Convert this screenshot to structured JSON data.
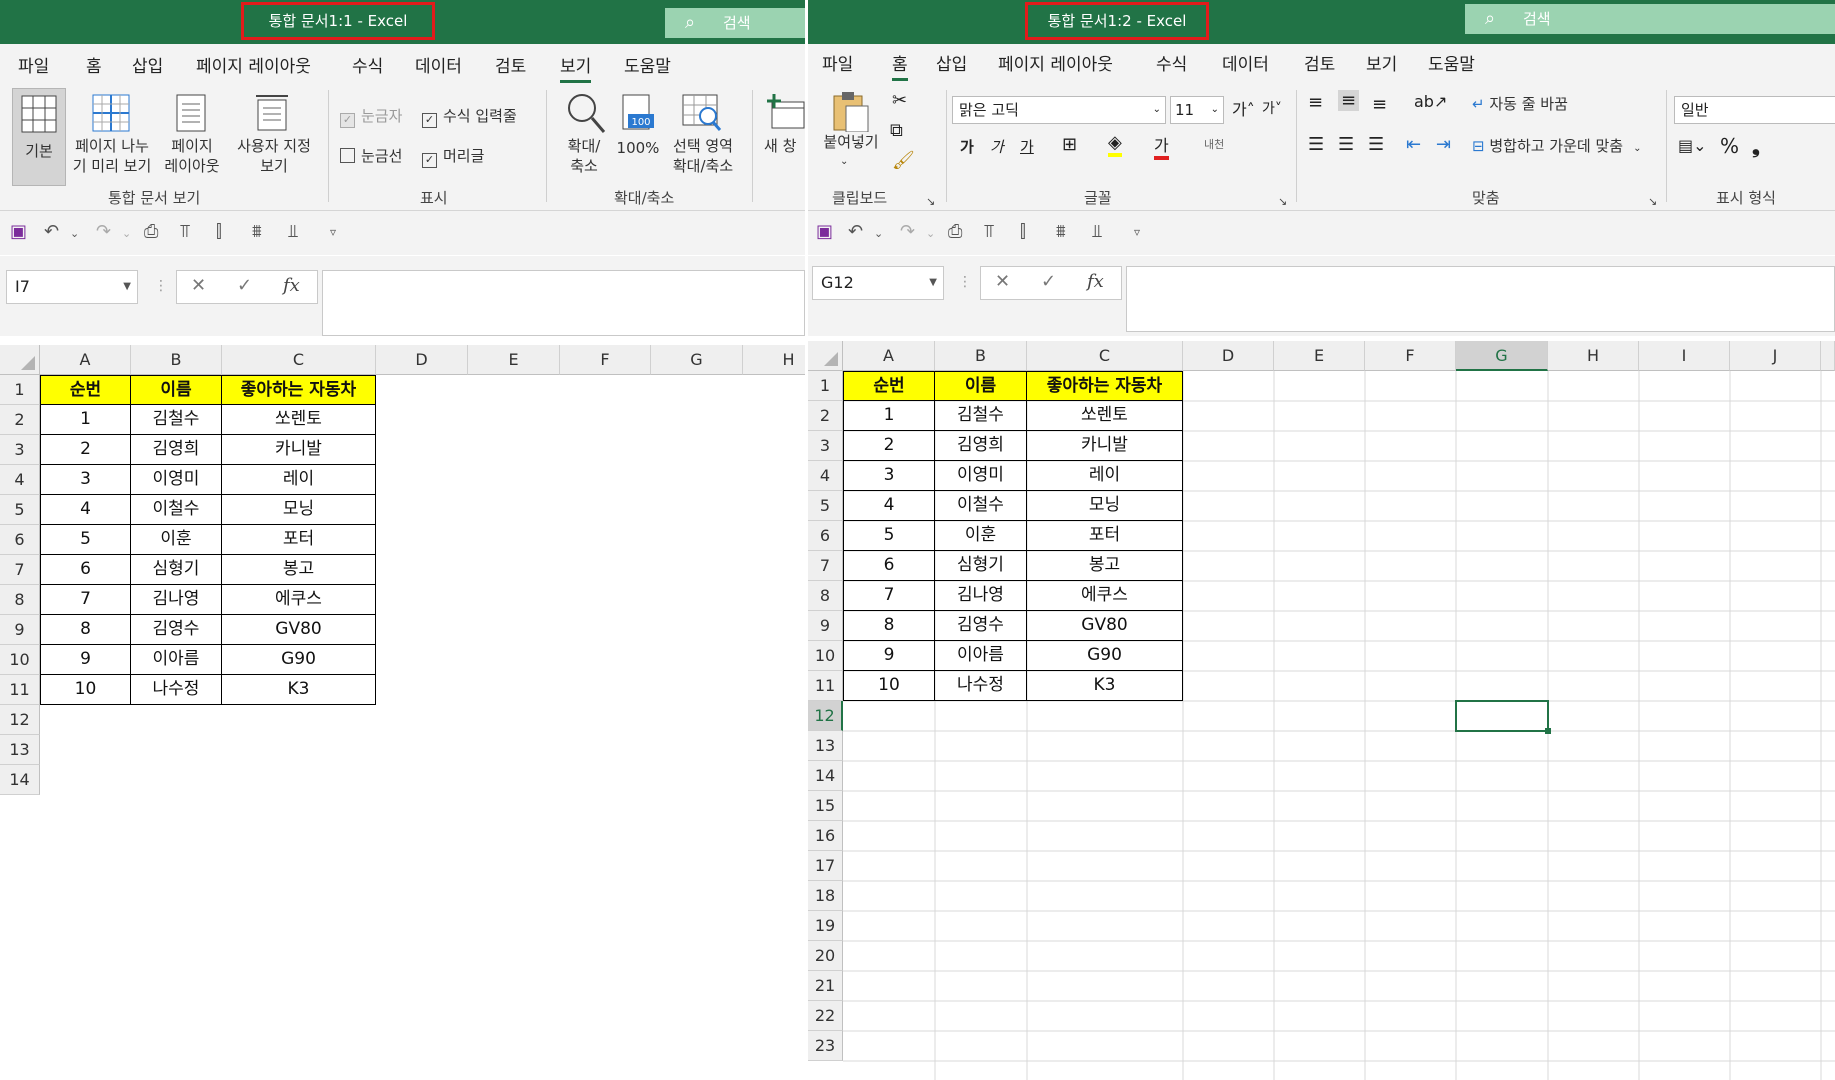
{
  "left": {
    "title": "통합 문서1:1  -  Excel",
    "search": "검색",
    "menus": [
      "파일",
      "홈",
      "삽입",
      "페이지 레이아웃",
      "수식",
      "데이터",
      "검토",
      "보기",
      "도움말"
    ],
    "active_menu_index": 7,
    "ribbon": {
      "normal": "기본",
      "pagebreak": "페이지 나누\n기 미리 보기",
      "pagelayout": "페이지\n레이아웃",
      "custom": "사용자 지정\n보기",
      "group_views": "통합 문서 보기",
      "ruler": "눈금자",
      "formula_bar": "수식 입력줄",
      "gridlines": "눈금선",
      "headings": "머리글",
      "group_show": "표시",
      "zoom": "확대/\n축소",
      "zoom100": "100%",
      "zoom_sel": "선택 영역\n확대/축소",
      "group_zoom": "확대/축소",
      "new_window": "새 창"
    },
    "namebox": "I7",
    "columns": [
      "A",
      "B",
      "C",
      "D",
      "E",
      "F",
      "G",
      "H"
    ],
    "rows": [
      "1",
      "2",
      "3",
      "4",
      "5",
      "6",
      "7",
      "8",
      "9",
      "10",
      "11",
      "12",
      "13",
      "14"
    ]
  },
  "right": {
    "title": "통합 문서1:2  -  Excel",
    "search": "검색",
    "menus": [
      "파일",
      "홈",
      "삽입",
      "페이지 레이아웃",
      "수식",
      "데이터",
      "검토",
      "보기",
      "도움말"
    ],
    "active_menu_index": 1,
    "ribbon": {
      "paste": "붙여넣기",
      "group_clipboard": "클립보드",
      "font_name": "맑은 고딕",
      "font_size": "11",
      "group_font": "글꼴",
      "wrap_text": "자동 줄 바꿈",
      "merge_center": "병합하고 가운데 맞춤",
      "group_align": "맞춤",
      "number_format": "일반",
      "group_number": "표시 형식"
    },
    "namebox": "G12",
    "columns": [
      "A",
      "B",
      "C",
      "D",
      "E",
      "F",
      "G",
      "H",
      "I",
      "J"
    ],
    "rows": [
      "1",
      "2",
      "3",
      "4",
      "5",
      "6",
      "7",
      "8",
      "9",
      "10",
      "11",
      "12",
      "13",
      "14",
      "15",
      "16",
      "17",
      "18",
      "19",
      "20",
      "21",
      "22",
      "23"
    ]
  },
  "table": {
    "headers": [
      "순번",
      "이름",
      "좋아하는 자동차"
    ],
    "rows": [
      [
        "1",
        "김철수",
        "쏘렌토"
      ],
      [
        "2",
        "김영희",
        "카니발"
      ],
      [
        "3",
        "이영미",
        "레이"
      ],
      [
        "4",
        "이철수",
        "모닝"
      ],
      [
        "5",
        "이훈",
        "포터"
      ],
      [
        "6",
        "심형기",
        "봉고"
      ],
      [
        "7",
        "김나영",
        "에쿠스"
      ],
      [
        "8",
        "김영수",
        "GV80"
      ],
      [
        "9",
        "이아름",
        "G90"
      ],
      [
        "10",
        "나수정",
        "K3"
      ]
    ]
  }
}
